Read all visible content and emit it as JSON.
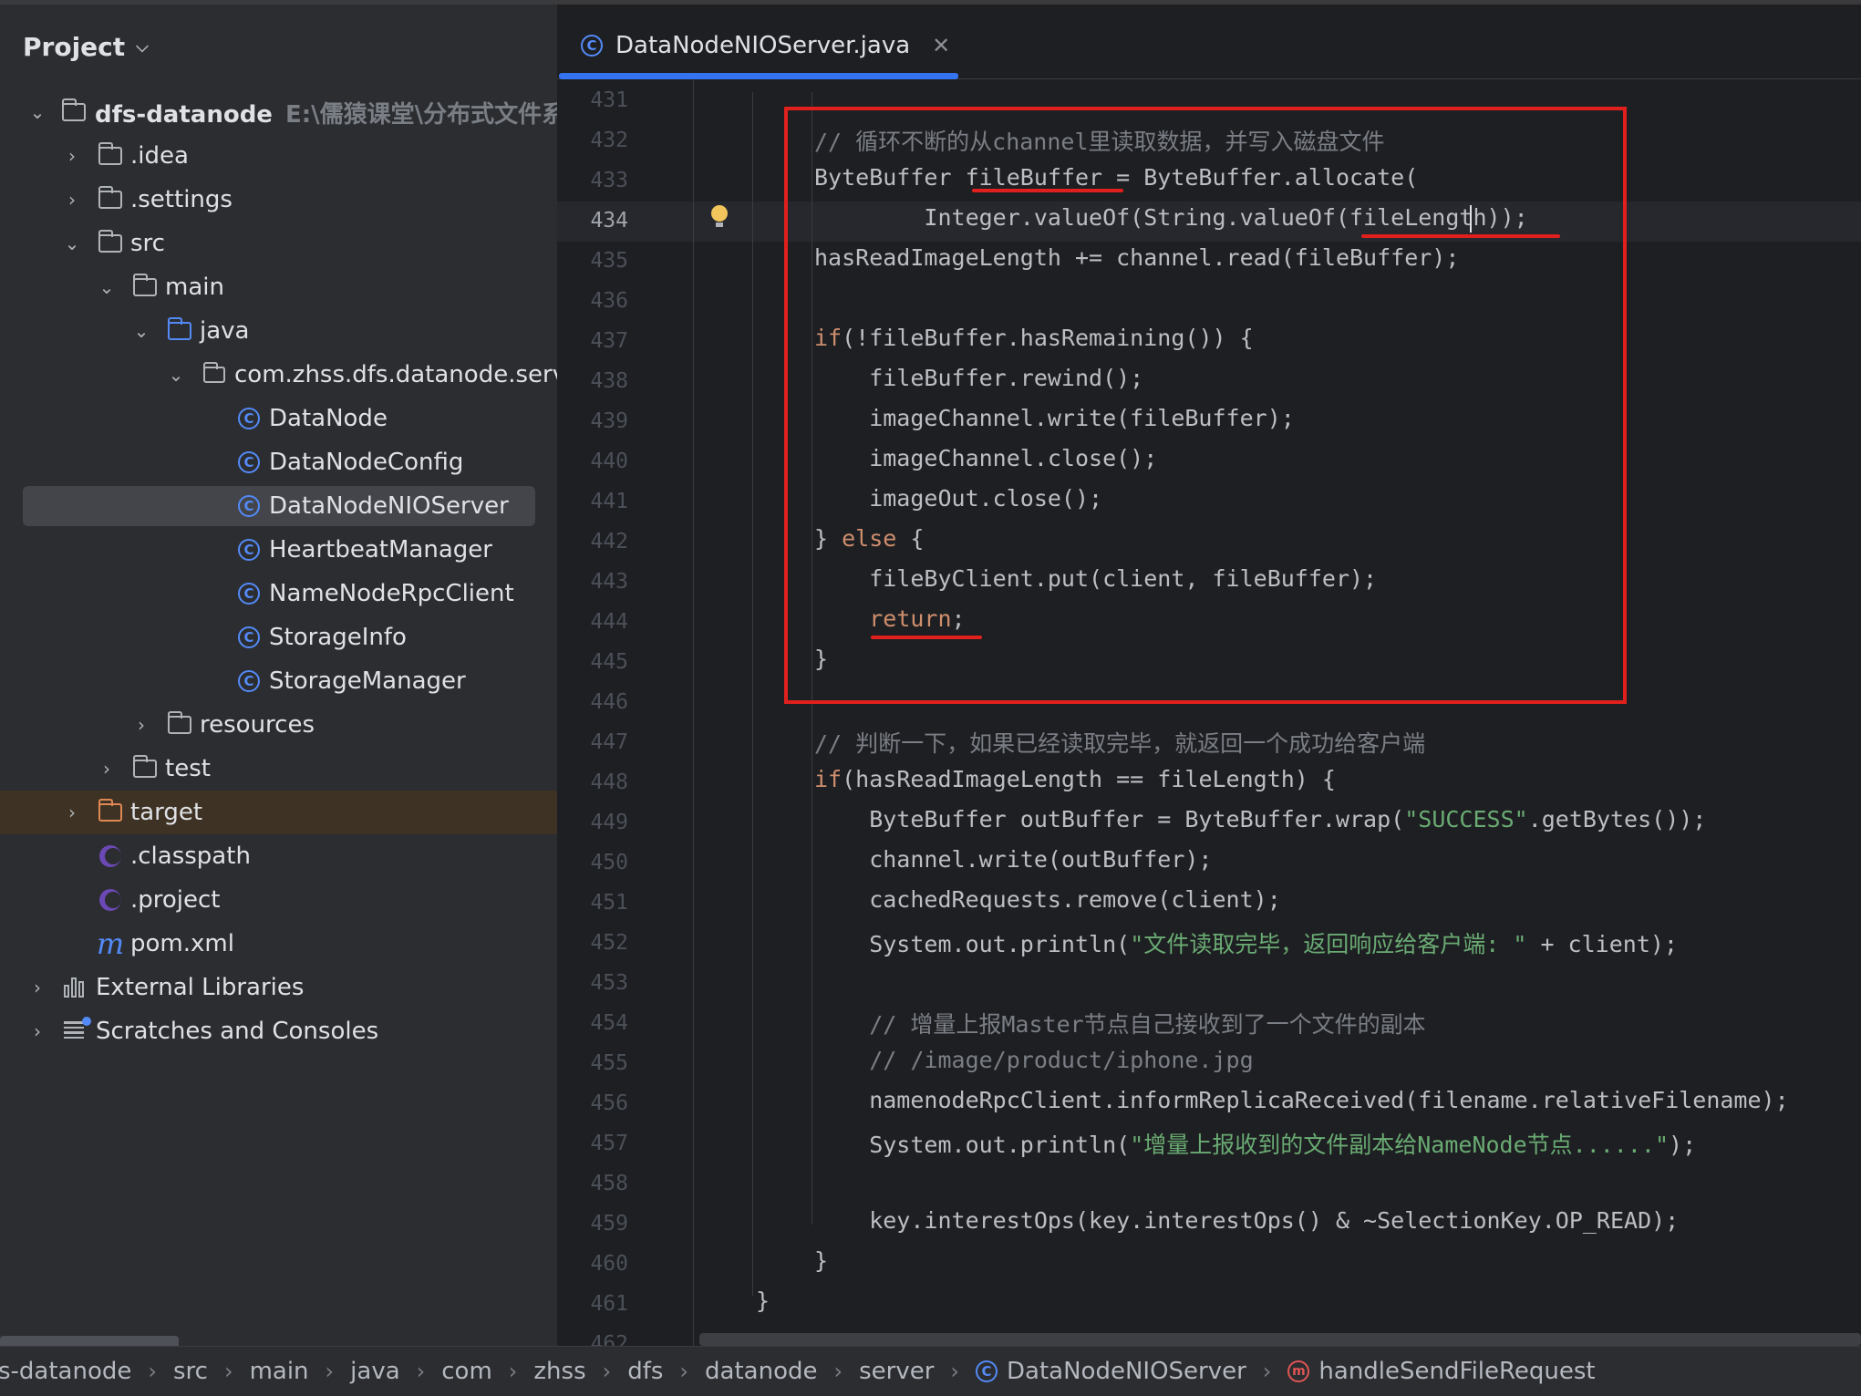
{
  "sidebar": {
    "title": "Project",
    "tree": [
      {
        "label": "dfs-datanode",
        "extra": "E:\\儒猿课堂\\分布式文件系统",
        "icon": "module-folder-icon",
        "arrow": "down"
      },
      {
        "label": ".idea",
        "icon": "folder-icon",
        "arrow": "right"
      },
      {
        "label": ".settings",
        "icon": "folder-icon",
        "arrow": "right"
      },
      {
        "label": "src",
        "icon": "folder-icon",
        "arrow": "down"
      },
      {
        "label": "main",
        "icon": "folder-icon",
        "arrow": "down"
      },
      {
        "label": "java",
        "icon": "source-folder-icon",
        "arrow": "down"
      },
      {
        "label": "com.zhss.dfs.datanode.server",
        "icon": "package-icon",
        "arrow": "down"
      },
      {
        "label": "DataNode",
        "icon": "class-icon",
        "arrow": ""
      },
      {
        "label": "DataNodeConfig",
        "icon": "class-icon",
        "arrow": ""
      },
      {
        "label": "DataNodeNIOServer",
        "icon": "class-icon",
        "arrow": "",
        "selected": true
      },
      {
        "label": "HeartbeatManager",
        "icon": "class-icon",
        "arrow": ""
      },
      {
        "label": "NameNodeRpcClient",
        "icon": "class-icon",
        "arrow": ""
      },
      {
        "label": "StorageInfo",
        "icon": "class-icon",
        "arrow": ""
      },
      {
        "label": "StorageManager",
        "icon": "class-icon",
        "arrow": ""
      },
      {
        "label": "resources",
        "icon": "resources-folder-icon",
        "arrow": "right"
      },
      {
        "label": "test",
        "icon": "folder-icon",
        "arrow": "right"
      },
      {
        "label": "target",
        "icon": "excluded-folder-icon",
        "arrow": "right"
      },
      {
        "label": ".classpath",
        "icon": "eclipse-file-icon",
        "arrow": ""
      },
      {
        "label": ".project",
        "icon": "eclipse-file-icon",
        "arrow": ""
      },
      {
        "label": "pom.xml",
        "icon": "maven-icon",
        "arrow": ""
      },
      {
        "label": "External Libraries",
        "icon": "libraries-icon",
        "arrow": "right"
      },
      {
        "label": "Scratches and Consoles",
        "icon": "scratches-icon",
        "arrow": "right"
      }
    ]
  },
  "editor": {
    "tab": {
      "label": "DataNodeNIOServer.java",
      "close": "✕"
    },
    "lines": [
      {
        "n": "431",
        "text": ""
      },
      {
        "n": "432",
        "text": "// 循环不断的从channel里读取数据，并写入磁盘文件"
      },
      {
        "n": "433",
        "text": "ByteBuffer fileBuffer = ByteBuffer.allocate("
      },
      {
        "n": "434",
        "text": "        Integer.valueOf(String.valueOf(fileLength));"
      },
      {
        "n": "435",
        "text": "hasReadImageLength += channel.read(fileBuffer);"
      },
      {
        "n": "436",
        "text": ""
      },
      {
        "n": "437",
        "text": "if(!fileBuffer.hasRemaining()) {"
      },
      {
        "n": "438",
        "text": "    fileBuffer.rewind();"
      },
      {
        "n": "439",
        "text": "    imageChannel.write(fileBuffer);"
      },
      {
        "n": "440",
        "text": "    imageChannel.close();"
      },
      {
        "n": "441",
        "text": "    imageOut.close();"
      },
      {
        "n": "442",
        "text": "} else {"
      },
      {
        "n": "443",
        "text": "    fileByClient.put(client, fileBuffer);"
      },
      {
        "n": "444",
        "text": "    return;"
      },
      {
        "n": "445",
        "text": "}"
      },
      {
        "n": "446",
        "text": ""
      },
      {
        "n": "447",
        "text": "// 判断一下，如果已经读取完毕，就返回一个成功给客户端"
      },
      {
        "n": "448",
        "text": "if(hasReadImageLength == fileLength) {"
      },
      {
        "n": "449",
        "text": "    ByteBuffer outBuffer = ByteBuffer.wrap(\"SUCCESS\".getBytes());"
      },
      {
        "n": "450",
        "text": "    channel.write(outBuffer);"
      },
      {
        "n": "451",
        "text": "    cachedRequests.remove(client);"
      },
      {
        "n": "452",
        "text": "    System.out.println(\"文件读取完毕，返回响应给客户端: \" + client);"
      },
      {
        "n": "453",
        "text": ""
      },
      {
        "n": "454",
        "text": "    // 增量上报Master节点自己接收到了一个文件的副本"
      },
      {
        "n": "455",
        "text": "    // /image/product/iphone.jpg"
      },
      {
        "n": "456",
        "text": "    namenodeRpcClient.informReplicaReceived(filename.relativeFilename);"
      },
      {
        "n": "457",
        "text": "    System.out.println(\"增量上报收到的文件副本给NameNode节点......\");"
      },
      {
        "n": "458",
        "text": ""
      },
      {
        "n": "459",
        "text": "    key.interestOps(key.interestOps() & ~SelectionKey.OP_READ);"
      },
      {
        "n": "460",
        "text": "}"
      },
      {
        "n": "461",
        "text": "}"
      },
      {
        "n": "462",
        "text": ""
      }
    ]
  },
  "breadcrumb": [
    "s-datanode",
    "src",
    "main",
    "java",
    "com",
    "zhss",
    "dfs",
    "datanode",
    "server",
    "DataNodeNIOServer",
    "handleSendFileRequest"
  ],
  "colors": {
    "keyword": "#cf8e6d",
    "comment": "#7a7e85",
    "string": "#6aab73",
    "annotation": "#e0201c",
    "accent": "#3574f0"
  }
}
